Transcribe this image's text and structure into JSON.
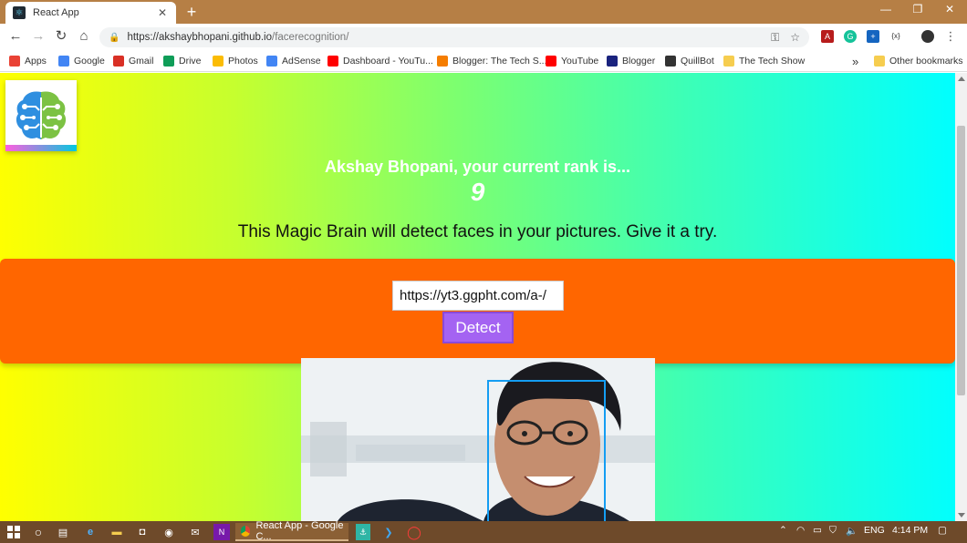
{
  "browser": {
    "tab_title": "React App",
    "tab_close": "✕",
    "new_tab": "+",
    "window_controls": {
      "minimize": "—",
      "maximize": "❐",
      "close": "✕"
    },
    "url_domain": "https://akshaybhopani.github.io",
    "url_path": "/facerecognition/",
    "bookmarks": [
      {
        "label": "Apps",
        "icon": "apps-grid-icon",
        "color": "#e94235"
      },
      {
        "label": "Google",
        "icon": "google-icon",
        "color": "#4285f4"
      },
      {
        "label": "Gmail",
        "icon": "gmail-icon",
        "color": "#d93025"
      },
      {
        "label": "Drive",
        "icon": "drive-icon",
        "color": "#0f9d58"
      },
      {
        "label": "Photos",
        "icon": "photos-icon",
        "color": "#fbbc04"
      },
      {
        "label": "AdSense",
        "icon": "adsense-icon",
        "color": "#4285f4"
      },
      {
        "label": "Dashboard - YouTu...",
        "icon": "youtube-icon",
        "color": "#ff0000"
      },
      {
        "label": "Blogger: The Tech S...",
        "icon": "blogger-icon",
        "color": "#f57d00"
      },
      {
        "label": "YouTube",
        "icon": "youtube-icon",
        "color": "#ff0000"
      },
      {
        "label": "Blogger",
        "icon": "blogger-dark-icon",
        "color": "#1a237e"
      },
      {
        "label": "QuillBot",
        "icon": "quillbot-icon",
        "color": "#333333"
      },
      {
        "label": "The Tech Show",
        "icon": "folder-icon",
        "color": "#f6cd4f"
      }
    ],
    "overflow": "»",
    "other_bookmarks": "Other bookmarks"
  },
  "page": {
    "rank_text": "Akshay Bhopani, your current rank is...",
    "rank_value": "9",
    "tagline": "This Magic Brain will detect faces in your pictures. Give it a try.",
    "image_url_input": "https://yt3.ggpht.com/a-/",
    "detect_label": "Detect",
    "colors": {
      "form_bg": "#ff6600",
      "button_bg": "#a463f2",
      "face_box": "#149df2"
    }
  },
  "taskbar": {
    "active_window": "React App - Google C...",
    "language": "ENG",
    "time": "4:14 PM"
  }
}
